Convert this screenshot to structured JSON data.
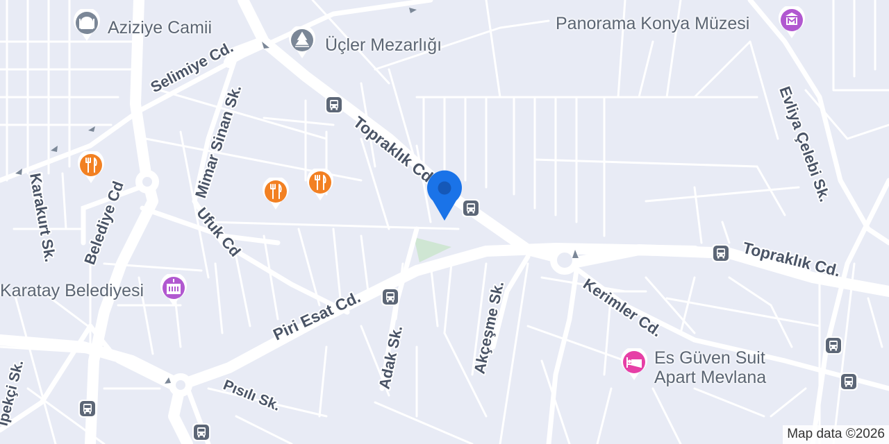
{
  "map": {
    "streets": {
      "selimiye": "Selimiye Cd.",
      "mimar_sinan": "Mimar Sinan Sk.",
      "topraklik_upper": "Topraklık Cd.",
      "topraklik_lower": "Topraklık Cd.",
      "belediye": "Belediye Cd",
      "ufuk": "Ufuk Cd",
      "karakurt": "Karakurt Sk.",
      "piri_esat": "Piri Esat Cd.",
      "adak": "Adak Sk.",
      "akcesme": "Akçeşme Sk.",
      "kerimler": "Kerimler Cd.",
      "evliya_celebi": "Evliya Çelebi Sk.",
      "pisili": "Pısılı Sk.",
      "ipekci": "İpekçi Sk."
    },
    "pois": {
      "aziziye": "Aziziye Camii",
      "ucler": "Üçler Mezarlığı",
      "panorama": "Panorama Konya Müzesi",
      "karatay": "Karatay Belediyesi",
      "es_guven_line1": "Es Güven Suit",
      "es_guven_line2": "Apart Mevlana"
    },
    "colors": {
      "background": "#e8ebf5",
      "road": "#ffffff",
      "poi_restaurant": "#f28022",
      "poi_civic": "#b158d0",
      "poi_hotel": "#e63fa6",
      "poi_gray": "#7b8797",
      "bus_stop": "#5c6676",
      "location_pin": "#1a73e8",
      "park": "#cfe6d3"
    },
    "icons": {
      "mosque": "mosque-icon",
      "cemetery": "cemetery-icon",
      "museum": "museum-icon",
      "restaurant": "restaurant-icon",
      "civic": "civic-building-icon",
      "hotel": "hotel-icon",
      "bus": "bus-stop-icon",
      "location": "location-pin-icon"
    },
    "attribution": "Map data ©2026"
  }
}
